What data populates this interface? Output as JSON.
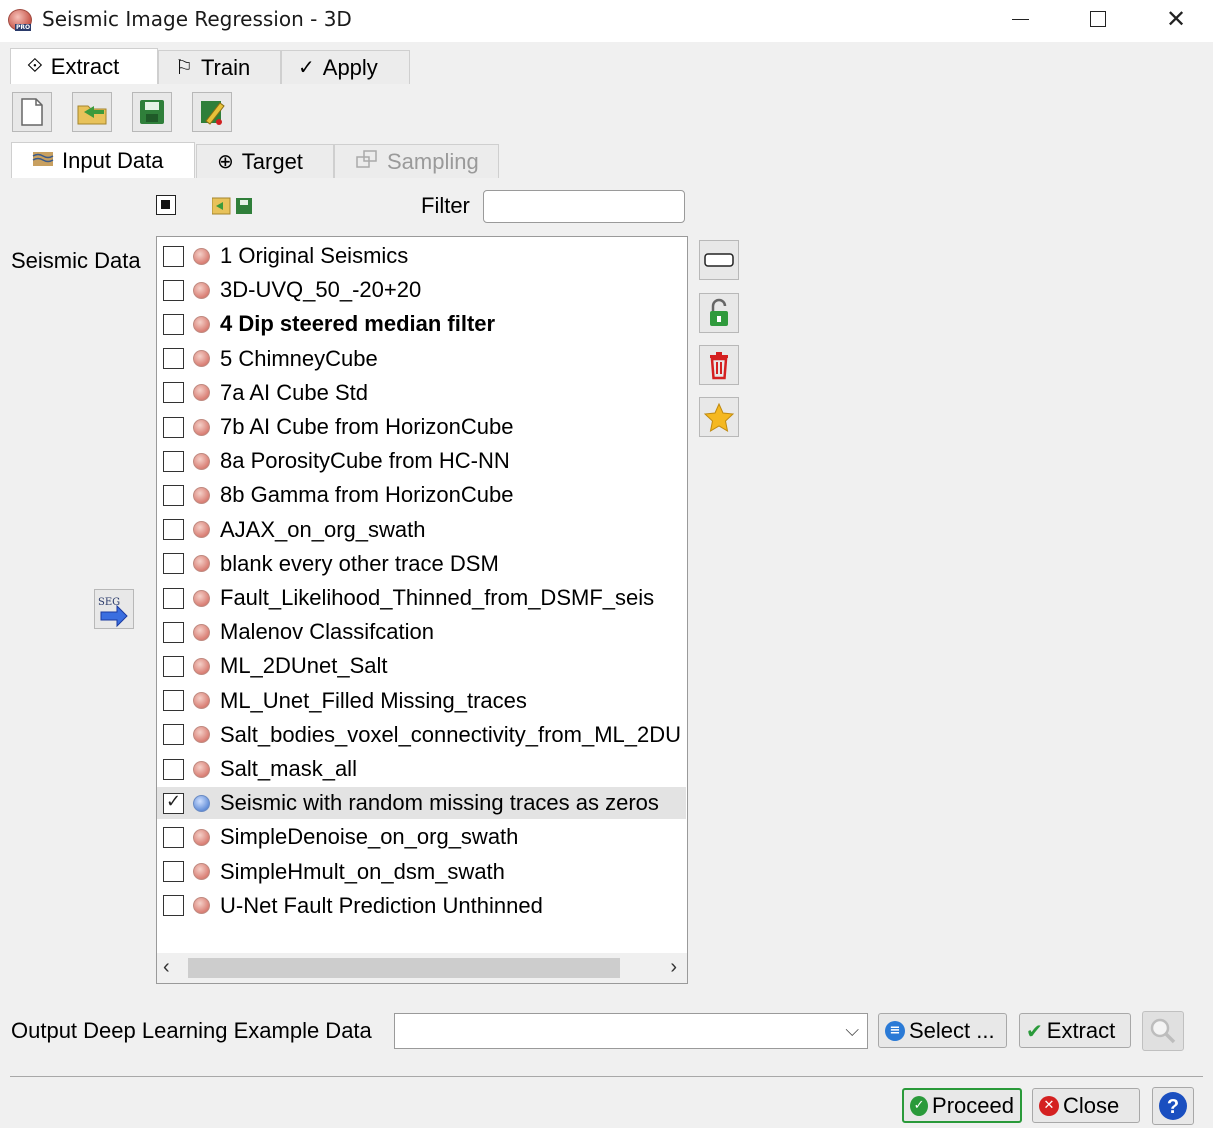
{
  "window": {
    "title": "Seismic Image Regression - 3D"
  },
  "tabs": [
    {
      "label": "Extract",
      "icon": "tag-icon"
    },
    {
      "label": "Train",
      "icon": "train-icon"
    },
    {
      "label": "Apply",
      "icon": "apply-check-icon"
    }
  ],
  "subtabs": [
    {
      "label": "Input Data",
      "icon": "seismic-icon"
    },
    {
      "label": "Target",
      "icon": "target-icon"
    },
    {
      "label": "Sampling",
      "icon": "sampling-icon"
    }
  ],
  "filter": {
    "label": "Filter",
    "value": ""
  },
  "seismic": {
    "label": "Seismic Data",
    "items": [
      {
        "label": "1 Original Seismics",
        "checked": false,
        "bold": false
      },
      {
        "label": "3D-UVQ_50_-20+20",
        "checked": false,
        "bold": false
      },
      {
        "label": "4 Dip steered median filter",
        "checked": false,
        "bold": true
      },
      {
        "label": "5 ChimneyCube",
        "checked": false,
        "bold": false
      },
      {
        "label": "7a AI Cube Std",
        "checked": false,
        "bold": false
      },
      {
        "label": "7b AI Cube from HorizonCube",
        "checked": false,
        "bold": false
      },
      {
        "label": "8a PorosityCube from HC-NN",
        "checked": false,
        "bold": false
      },
      {
        "label": "8b Gamma from HorizonCube",
        "checked": false,
        "bold": false
      },
      {
        "label": "AJAX_on_org_swath",
        "checked": false,
        "bold": false
      },
      {
        "label": "blank every other trace DSM",
        "checked": false,
        "bold": false
      },
      {
        "label": "Fault_Likelihood_Thinned_from_DSMF_seis",
        "checked": false,
        "bold": false
      },
      {
        "label": "Malenov Classifcation",
        "checked": false,
        "bold": false
      },
      {
        "label": "ML_2DUnet_Salt",
        "checked": false,
        "bold": false
      },
      {
        "label": "ML_Unet_Filled Missing_traces",
        "checked": false,
        "bold": false
      },
      {
        "label": "Salt_bodies_voxel_connectivity_from_ML_2DU",
        "checked": false,
        "bold": false
      },
      {
        "label": "Salt_mask_all",
        "checked": false,
        "bold": false
      },
      {
        "label": "Seismic with random missing traces as zeros",
        "checked": true,
        "bold": false
      },
      {
        "label": "SimpleDenoise_on_org_swath",
        "checked": false,
        "bold": false
      },
      {
        "label": "SimpleHmult_on_dsm_swath",
        "checked": false,
        "bold": false
      },
      {
        "label": "U-Net Fault Prediction Unthinned",
        "checked": false,
        "bold": false
      }
    ]
  },
  "output": {
    "label": "Output Deep Learning Example Data",
    "value": ""
  },
  "buttons": {
    "select": "Select ...",
    "extract": "Extract",
    "proceed": "Proceed",
    "close": "Close"
  }
}
